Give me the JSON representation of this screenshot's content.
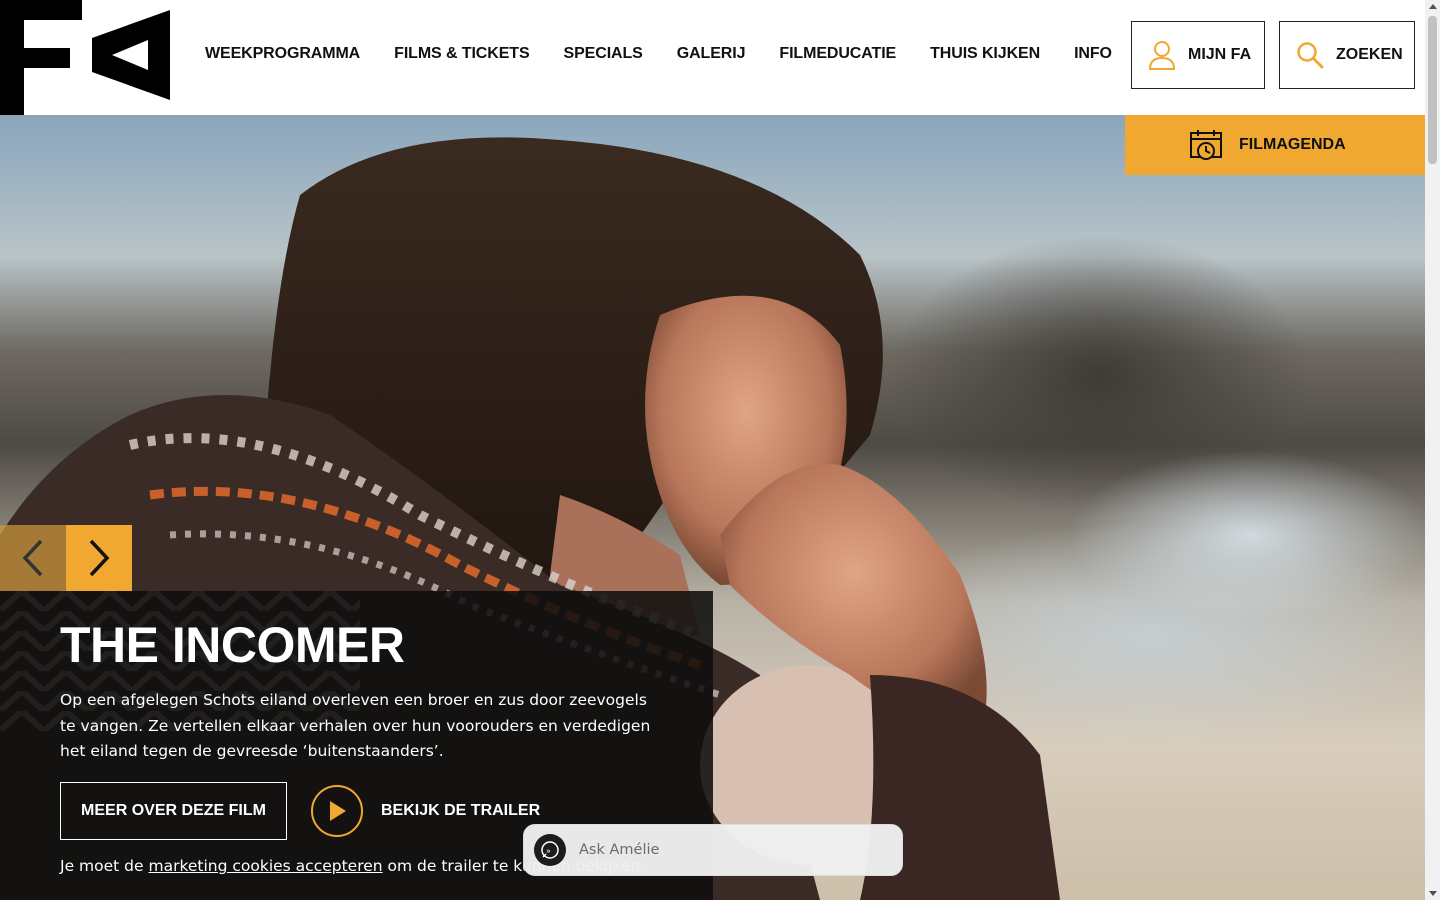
{
  "header": {
    "logo_text": "FA",
    "nav": [
      {
        "label": "WEEKPROGRAMMA"
      },
      {
        "label": "FILMS & TICKETS"
      },
      {
        "label": "SPECIALS"
      },
      {
        "label": "GALERIJ"
      },
      {
        "label": "FILMEDUCATIE"
      },
      {
        "label": "THUIS KIJKEN"
      },
      {
        "label": "INFO"
      }
    ],
    "account_button": {
      "label": "MIJN FA",
      "icon": "user-icon"
    },
    "search_button": {
      "label": "ZOEKEN",
      "icon": "search-icon"
    }
  },
  "filmagenda": {
    "label": "FILMAGENDA",
    "icon": "calendar-clock-icon"
  },
  "hero": {
    "title": "THE INCOMER",
    "description": "Op een afgelegen Schots eiland overleven een broer en zus door zeevogels te vangen. Ze vertellen elkaar verhalen over hun voorouders en verdedigen het eiland tegen de gevreesde ‘buitenstaanders’.",
    "more_button": "MEER OVER DEZE FILM",
    "trailer_label": "BEKIJK DE TRAILER",
    "cookie_prefix": "Je moet de ",
    "cookie_link": "marketing cookies accepteren",
    "cookie_suffix": " om de trailer te kunnen bekijken.",
    "prev_icon": "chevron-left-icon",
    "next_icon": "chevron-right-icon"
  },
  "chat": {
    "placeholder": "Ask Amélie",
    "icon": "chat-bubble-icon"
  },
  "colors": {
    "accent": "#f0a830",
    "dark": "#111111",
    "white": "#ffffff"
  }
}
